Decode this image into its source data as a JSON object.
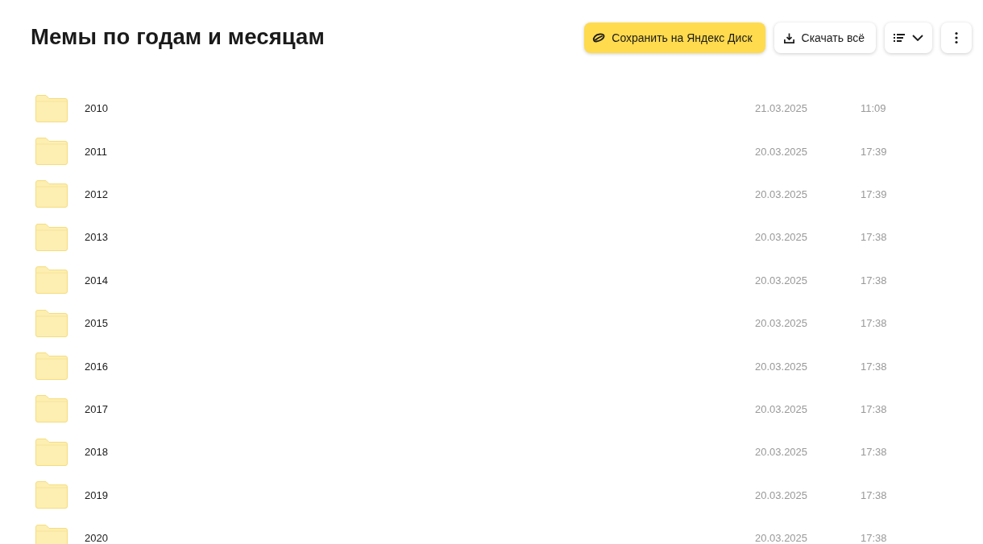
{
  "title": "Мемы по годам и месяцам",
  "toolbar": {
    "save_button": "Сохранить на Яндекс Диск",
    "download_button": "Скачать всё"
  },
  "files": [
    {
      "name": "2010",
      "date": "21.03.2025",
      "time": "11:09"
    },
    {
      "name": "2011",
      "date": "20.03.2025",
      "time": "17:39"
    },
    {
      "name": "2012",
      "date": "20.03.2025",
      "time": "17:39"
    },
    {
      "name": "2013",
      "date": "20.03.2025",
      "time": "17:38"
    },
    {
      "name": "2014",
      "date": "20.03.2025",
      "time": "17:38"
    },
    {
      "name": "2015",
      "date": "20.03.2025",
      "time": "17:38"
    },
    {
      "name": "2016",
      "date": "20.03.2025",
      "time": "17:38"
    },
    {
      "name": "2017",
      "date": "20.03.2025",
      "time": "17:38"
    },
    {
      "name": "2018",
      "date": "20.03.2025",
      "time": "17:38"
    },
    {
      "name": "2019",
      "date": "20.03.2025",
      "time": "17:38"
    },
    {
      "name": "2020",
      "date": "20.03.2025",
      "time": "17:38"
    }
  ]
}
